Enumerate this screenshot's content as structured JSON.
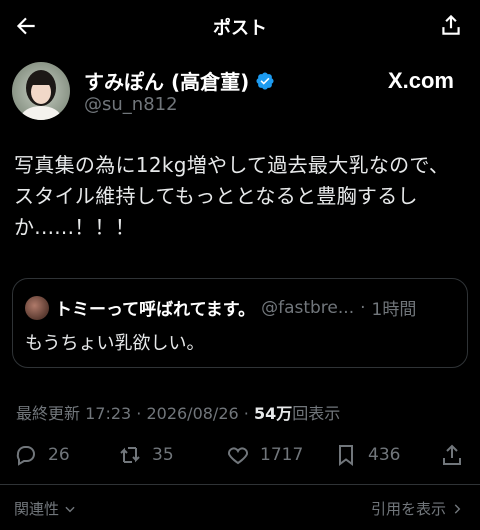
{
  "header": {
    "title": "ポスト"
  },
  "author": {
    "name": "すみぽん (高倉菫)",
    "handle": "@su_n812",
    "site_logo": "X.com"
  },
  "tweet": {
    "lines": [
      "写真集の為に12kg増やして過去最大乳なので、",
      "スタイル維持してもっととなると豊胸するし",
      "か......！！！"
    ]
  },
  "quote": {
    "name": "トミーって呼ばれてます。",
    "handle": "@fastbre...",
    "separator": "·",
    "time": "1時間",
    "text": "もうちょい乳欲しい。"
  },
  "meta": {
    "prefix": "最終更新 17:23 · 2026/08/26 · ",
    "views": "54万",
    "views_label": "回表示"
  },
  "actions": {
    "replies": "26",
    "retweets": "35",
    "likes": "1717",
    "bookmarks": "436"
  },
  "footer": {
    "related": "関連性",
    "show_quotes": "引用を表示"
  },
  "colors": {
    "background": "#000000",
    "text": "#e7e9ea",
    "muted": "#71767b",
    "verified": "#1d9bf0",
    "border": "#2f3336"
  }
}
